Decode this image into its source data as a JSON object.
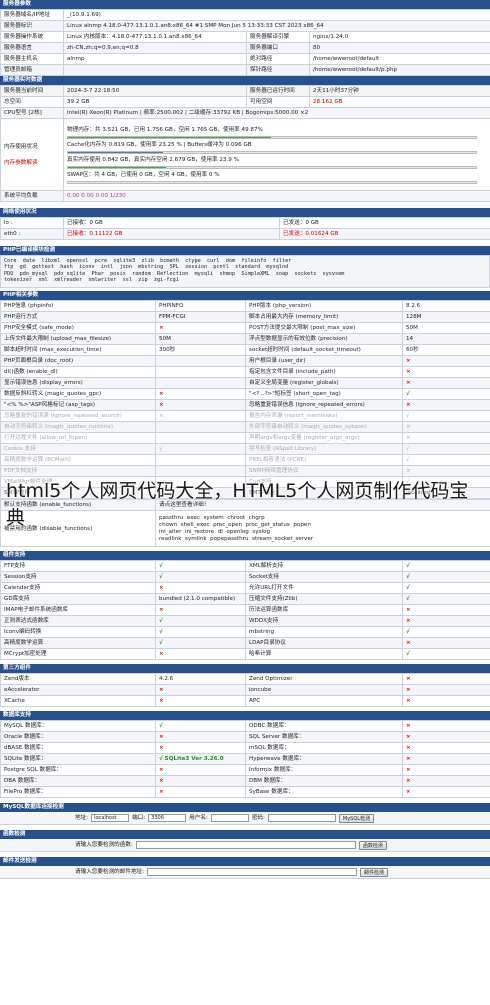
{
  "overlay_title": "html5个人网页代码大全，HTML5个人网页制作代码宝典",
  "server_params": {
    "title": "服务器参数",
    "rows": [
      [
        "服务器域名/IP地址",
        "_(10.9.1.69)",
        "",
        ""
      ],
      [
        "服务器标识",
        "Linux alnmp 4.18.0-477.13.1.0.1.an8.x86_64 #1 SMP Mon Jun 5 13:33:33 CST 2023 x86_64",
        "",
        ""
      ],
      [
        "服务器操作系统",
        "Linux 内核版本：4.18.0-477.13.1.0.1.an8.x86_64",
        "服务器解译引擎",
        "nginx/1.24.0"
      ],
      [
        "服务器语言",
        "zh-CN,zh;q=0.9,en;q=0.8",
        "服务器端口",
        "80"
      ],
      [
        "服务器主机名",
        "alnmp",
        "绝对路径",
        "/home/wwwroot/default"
      ],
      [
        "管理员邮箱",
        "",
        "探针路径",
        "/home/wwwroot/default/p.php"
      ]
    ]
  },
  "realtime": {
    "title": "服务器实时数据",
    "time_label": "服务器当前时间",
    "time_value": "2024-3-7 22:18:50",
    "uptime_label": "服务器已运行时间",
    "uptime_value": "2天11小时37分钟",
    "space_label": "总空间",
    "space_value": "39.2 GB",
    "free_label": "可用空间",
    "free_value": "28.162 GB",
    "cpu_label": "CPU型号 [2核]",
    "cpu_value": "Intel(R) Xeon(R) Platinum | 频率:2500.002 | 二级缓存:33792 KB | Bogomips:5000.00 ×2",
    "mem_label": "内存使用状况",
    "mem_note_label": "内存参数解读",
    "mem_lines": [
      "物理内存：共 3.521 GB，已用 1.756 GB，空闲 1.765 GB，使用率 49.87%",
      "Cache化内存为 0.819 GB，使用率 23.25 % | Buffers缓冲为 0.096 GB",
      "真实内存使用 0.842 GB，真实内存空闲 2.679 GB，使用率 23.9 %",
      "SWAP区：共 4 GB，已使用 0 GB，空闲 4 GB，使用率 0 %"
    ],
    "mem_bars": [
      49.87,
      23.25,
      23.9,
      0
    ],
    "load_label": "系统平均负载",
    "load_value": "0.00 0.00 0.00 1/230"
  },
  "network": {
    "title": "网络使用状况",
    "rows": [
      [
        "lo :",
        "已接收：0 GB",
        "已发送：0 GB"
      ],
      [
        "eth0 :",
        "已接收：0.11122 GB",
        "已发送：0.01624 GB"
      ]
    ]
  },
  "php_modules": {
    "title": "PHP已编译模块检测",
    "text": "Core  date  libxml  openssl  pcre  sqlite3  zlib  bcmath  ctype  curl  dom  fileinfo  filter\nftp  gd  gettext  hash  iconv  intl  json  mbstring  SPL  session  pcntl  standard  mysqlnd\nPDO  pdo_mysql  pdo_sqlite  Phar  posix  random  Reflection  mysqli  shmop  SimpleXML  soap  sockets  sysvsem\ntokenizer  xml  xmlreader  xmlwriter  xsl  zip  zgi-fcgi"
  },
  "php_params": {
    "title": "PHP相关参数",
    "rows": [
      [
        "PHP信息 (phpinfo)",
        "PHPINFO",
        "PHP版本 (php_version)",
        "8.2.6"
      ],
      [
        "PHP运行方式",
        "FPM-FCGI",
        "脚本占用最大内存 (memory_limit)",
        "128M"
      ],
      [
        "PHP安全模式 (safe_mode)",
        "×",
        "POST方法提交最大限制 (post_max_size)",
        "50M"
      ],
      [
        "上传文件最大限制 (upload_max_filesize)",
        "50M",
        "浮点型数据显示的有效位数 (precision)",
        "14"
      ],
      [
        "脚本超时时间 (max_execution_time)",
        "300秒",
        "socket超时时间 (default_socket_timeout)",
        "60秒"
      ],
      [
        "PHP页面根目录 (doc_root)",
        "",
        "用户根目录 (user_dir)",
        "×"
      ],
      [
        "dl()函数 (enable_dl)",
        "",
        "指定包含文件目录 (include_path)",
        "×"
      ],
      [
        "显示错误信息 (display_errors)",
        "",
        "自定义全局变量 (register_globals)",
        "×"
      ],
      [
        "数据反斜杠转义 (magic_quotes_gpc)",
        "×",
        "\"<?...?>\"短标签 (short_open_tag)",
        "√"
      ],
      [
        "\"<% %>\"ASP风格标记 (asp_tags)",
        "×",
        "忽略重复错误信息 (ignore_repeated_errors)",
        "×"
      ],
      [
        "忽略重复的错误源 (ignore_repeated_source)",
        "×",
        "报告内存泄漏 (report_memleaks)",
        "√"
      ],
      [
        "自动字符串转义 (magic_quotes_runtime)",
        "",
        "外部字符串自动转义 (magic_quotes_sybase)",
        "×"
      ],
      [
        "打开远程文件 (allow_url_fopen)",
        "",
        "声明argv和argc变量 (register_argc_argv)",
        "×"
      ],
      [
        "Cookie 支持",
        "√",
        "拼写检查 (ASpell Library)",
        "√"
      ],
      [
        "高精度数学运算 (BCMath)",
        "",
        "PREL相容语法 (PCRE)",
        "√"
      ],
      [
        "PDF文档支持",
        "",
        "SNMP网络管理协议",
        "×"
      ],
      [
        "VMailMgr邮件处理",
        "",
        "Curl支持",
        "√"
      ],
      [
        "SMTP支持",
        "√",
        "SMTP地址",
        "localhost"
      ]
    ],
    "default_fn_label": "默认支持函数 (enable_functions)",
    "default_fn_value": "请点这里查看详细！",
    "disabled_fn_label": "被禁用的函数 (disable_functions)",
    "disabled_fn_value": "passthru  exec  system  chroot  chgrp\nchown  shell_exec  proc_open  proc_get_status  popen\nini_alter  ini_restore  dl  openlog  syslog\nreadlink  symlink  popepassthru  stream_socket_server"
  },
  "components": {
    "title": "组件支持",
    "rows": [
      [
        "FTP支持",
        "√",
        "XML解析支持",
        "√"
      ],
      [
        "Session支持",
        "√",
        "Socket支持",
        "√"
      ],
      [
        "Calendar支持",
        "×",
        "允许URL打开文件",
        "√"
      ],
      [
        "GD库支持",
        "bundled (2.1.0 compatible)",
        "压缩文件支持(Zlib)",
        "√"
      ],
      [
        "IMAP电子邮件系统函数库",
        "×",
        "历法运算函数库",
        "×"
      ],
      [
        "正则表达式函数库",
        "√",
        "WDDX支持",
        "×"
      ],
      [
        "Iconv编码转换",
        "√",
        "mbstring",
        "√"
      ],
      [
        "高精度数学运算",
        "√",
        "LDAP目录协议",
        "×"
      ],
      [
        "MCrypt加密处理",
        "×",
        "哈希计算",
        "√"
      ]
    ]
  },
  "third_party": {
    "title": "第三方组件",
    "rows": [
      [
        "Zend版本",
        "4.2.6",
        "Zend Optimizer",
        "×"
      ],
      [
        "eAccelerator",
        "×",
        "ioncube",
        "×"
      ],
      [
        "XCache",
        "×",
        "APC",
        "×"
      ]
    ]
  },
  "database": {
    "title": "数据库支持",
    "rows": [
      [
        "MySQL 数据库：",
        "√",
        "ODBC 数据库：",
        "×"
      ],
      [
        "Oracle 数据库：",
        "×",
        "SQL Server 数据库：",
        "×"
      ],
      [
        "dBASE 数据库：",
        "×",
        "mSQL 数据库：",
        "×"
      ],
      [
        "SQLite 数据库：",
        "√  SQLite3  Ver 3.26.0",
        "Hyperwave 数据库：",
        "×"
      ],
      [
        "Postgre SQL 数据库：",
        "×",
        "Informix 数据库：",
        "×"
      ],
      [
        "DBA 数据库：",
        "×",
        "DBM 数据库：",
        "×"
      ],
      [
        "FilePro 数据库：",
        "×",
        "SyBase 数据库：",
        "×"
      ]
    ]
  },
  "mysql_test": {
    "title": "MySQL数据库连接检测",
    "addr_label": "地址:",
    "addr_value": "localhost",
    "port_label": "端口:",
    "port_value": "3306",
    "user_label": "用户名:",
    "user_value": "",
    "pass_label": "密码:",
    "pass_value": "",
    "button": "MySQL检测"
  },
  "func_test": {
    "title": "函数检测",
    "label": "请输入您要检测的函数:",
    "button": "函数检测"
  },
  "mail_test": {
    "title": "邮件发送检测",
    "label": "请输入您要检测的邮件地址:",
    "button": "邮件检测"
  },
  "colors": {
    "header": "#28508d",
    "red": "#cc0000",
    "green": "#1c8c1c",
    "bar_green": "#3fae3f",
    "bar_blue": "#3d7fd1"
  }
}
